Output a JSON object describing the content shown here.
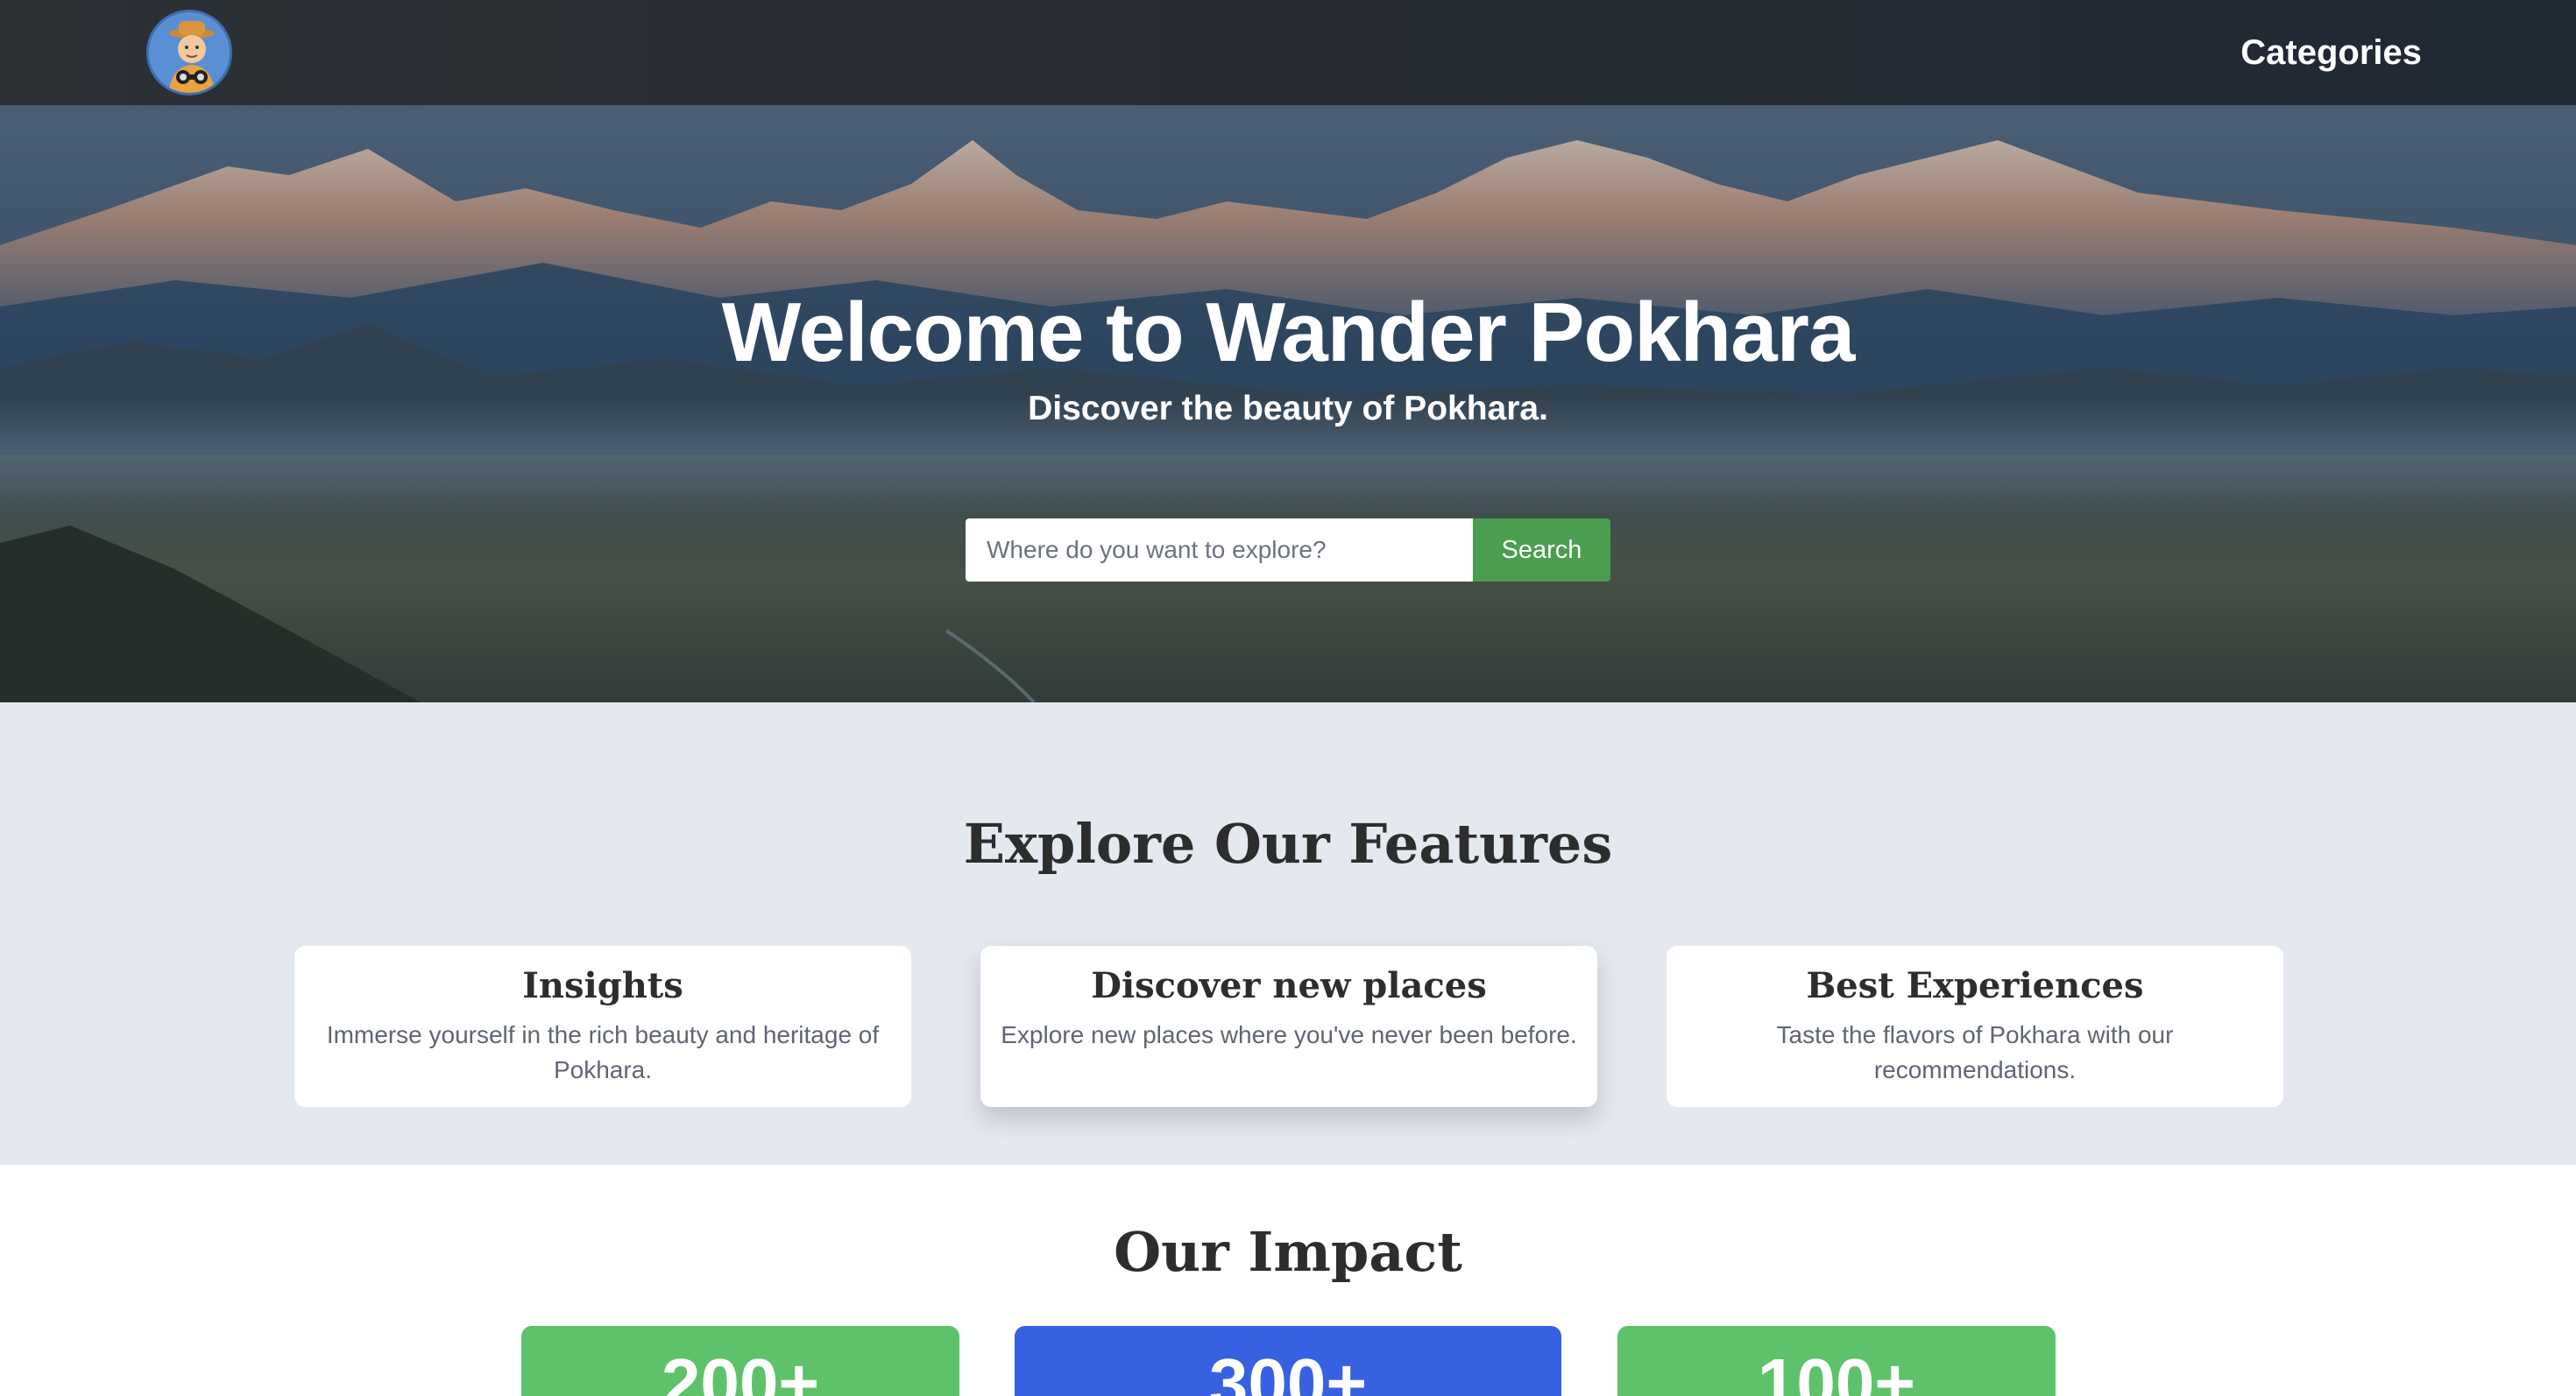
{
  "nav": {
    "logo_alt": "explorer-avatar",
    "link_label": "Categories"
  },
  "hero": {
    "title": "Welcome to Wander Pokhara",
    "subtitle": "Discover the beauty of Pokhara.",
    "search": {
      "placeholder": "Where do you want to explore?",
      "value": "",
      "button_label": "Search"
    }
  },
  "features": {
    "title": "Explore Our Features",
    "cards": [
      {
        "title": "Insights",
        "text": "Immerse yourself in the rich beauty and heritage of Pokhara."
      },
      {
        "title": "Discover new places",
        "text": "Explore new places where you've never been before."
      },
      {
        "title": "Best Experiences",
        "text": "Taste the flavors of Pokhara with our recommendations."
      }
    ]
  },
  "impact": {
    "title": "Our Impact",
    "stats": [
      {
        "value": "200+",
        "color": "#5ec26a"
      },
      {
        "value": "300+",
        "color": "#3761e0"
      },
      {
        "value": "100+",
        "color": "#5ec26a"
      }
    ]
  },
  "colors": {
    "navbar": "#262c32",
    "search_button": "#4b9e50",
    "features_bg": "#e4e8ef"
  }
}
